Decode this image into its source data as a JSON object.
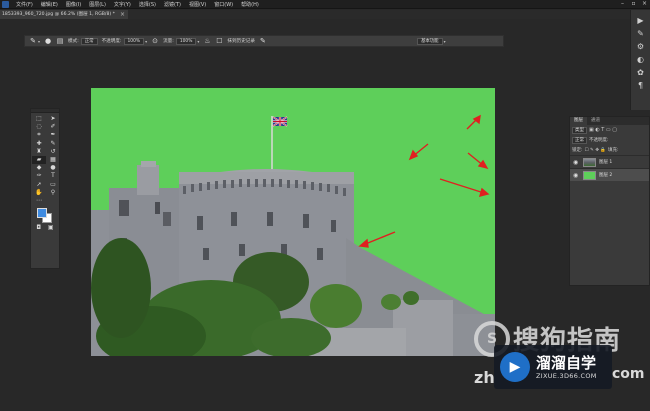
{
  "menubar": {
    "items": [
      "文件(F)",
      "编辑(E)",
      "图像(I)",
      "图层(L)",
      "文字(Y)",
      "选择(S)",
      "滤镜(T)",
      "视图(V)",
      "窗口(W)",
      "帮助(H)"
    ]
  },
  "document": {
    "tab_title": "1853393_960_720.jpg @ 66.2% (图层 1, RGB/8) *"
  },
  "options_bar": {
    "mode_label": "模式:",
    "mode_value": "正常",
    "opacity_label": "不透明度:",
    "opacity_value": "100%",
    "flow_label": "流量:",
    "flow_value": "100%",
    "erase_history_label": "抹到历史记录",
    "workspace_value": "基本功能"
  },
  "tools_panel": {
    "foreground_color": "#3f8be0",
    "background_color": "#ffffff",
    "tools": [
      "move-icon",
      "marquee-icon",
      "lasso-icon",
      "quick-select-icon",
      "crop-icon",
      "eyedropper-icon",
      "healing-icon",
      "brush-icon",
      "stamp-icon",
      "history-brush-icon",
      "eraser-icon",
      "gradient-icon",
      "blur-icon",
      "dodge-icon",
      "pen-icon",
      "type-icon",
      "path-select-icon",
      "shape-icon",
      "hand-icon",
      "zoom-icon"
    ]
  },
  "layers_panel": {
    "tabs": [
      "图层",
      "通道"
    ],
    "filter_value": "类型",
    "blend_value": "正常",
    "opacity_label": "不透明度:",
    "lock_label": "锁定:",
    "fill_label": "填充:",
    "layers": [
      {
        "name": "图层 1",
        "thumb": "photo"
      },
      {
        "name": "图层 2",
        "thumb": "green"
      }
    ]
  },
  "colors": {
    "canvas_background": "#5ecf5a",
    "arrow_color": "#e02020",
    "ui_dark": "#282828"
  },
  "watermarks": {
    "sogou_text": "搜狗指南",
    "sogou_prefix": "zh",
    "sogou_suffix": "com",
    "brand_name": "溜溜自学",
    "brand_url": "ZIXUE.3D66.COM"
  }
}
